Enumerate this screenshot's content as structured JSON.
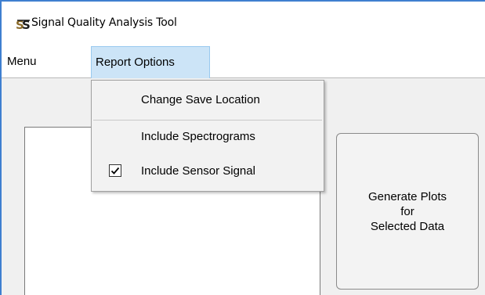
{
  "window": {
    "title": "Signal Quality Analysis Tool",
    "icon": "ss-logo-icon"
  },
  "menubar": {
    "items": [
      {
        "label": "Menu"
      },
      {
        "label": "Report Options",
        "state": "open"
      }
    ]
  },
  "report_options_menu": {
    "items": [
      {
        "label": "Change Save Location",
        "checked": false
      },
      {
        "label": "Include Spectrograms",
        "checked": false
      },
      {
        "label": "Include Sensor Signal",
        "checked": true
      }
    ]
  },
  "main": {
    "generate_button": {
      "line1": "Generate Plots",
      "line2": "for",
      "line3": "Selected Data"
    }
  },
  "colors": {
    "accent_border": "#3f7fd0",
    "menu_highlight": "#cce4f7",
    "menu_highlight_border": "#99c9ef",
    "panel_background": "#f0f0f0",
    "dropdown_background": "#f2f2f2"
  }
}
